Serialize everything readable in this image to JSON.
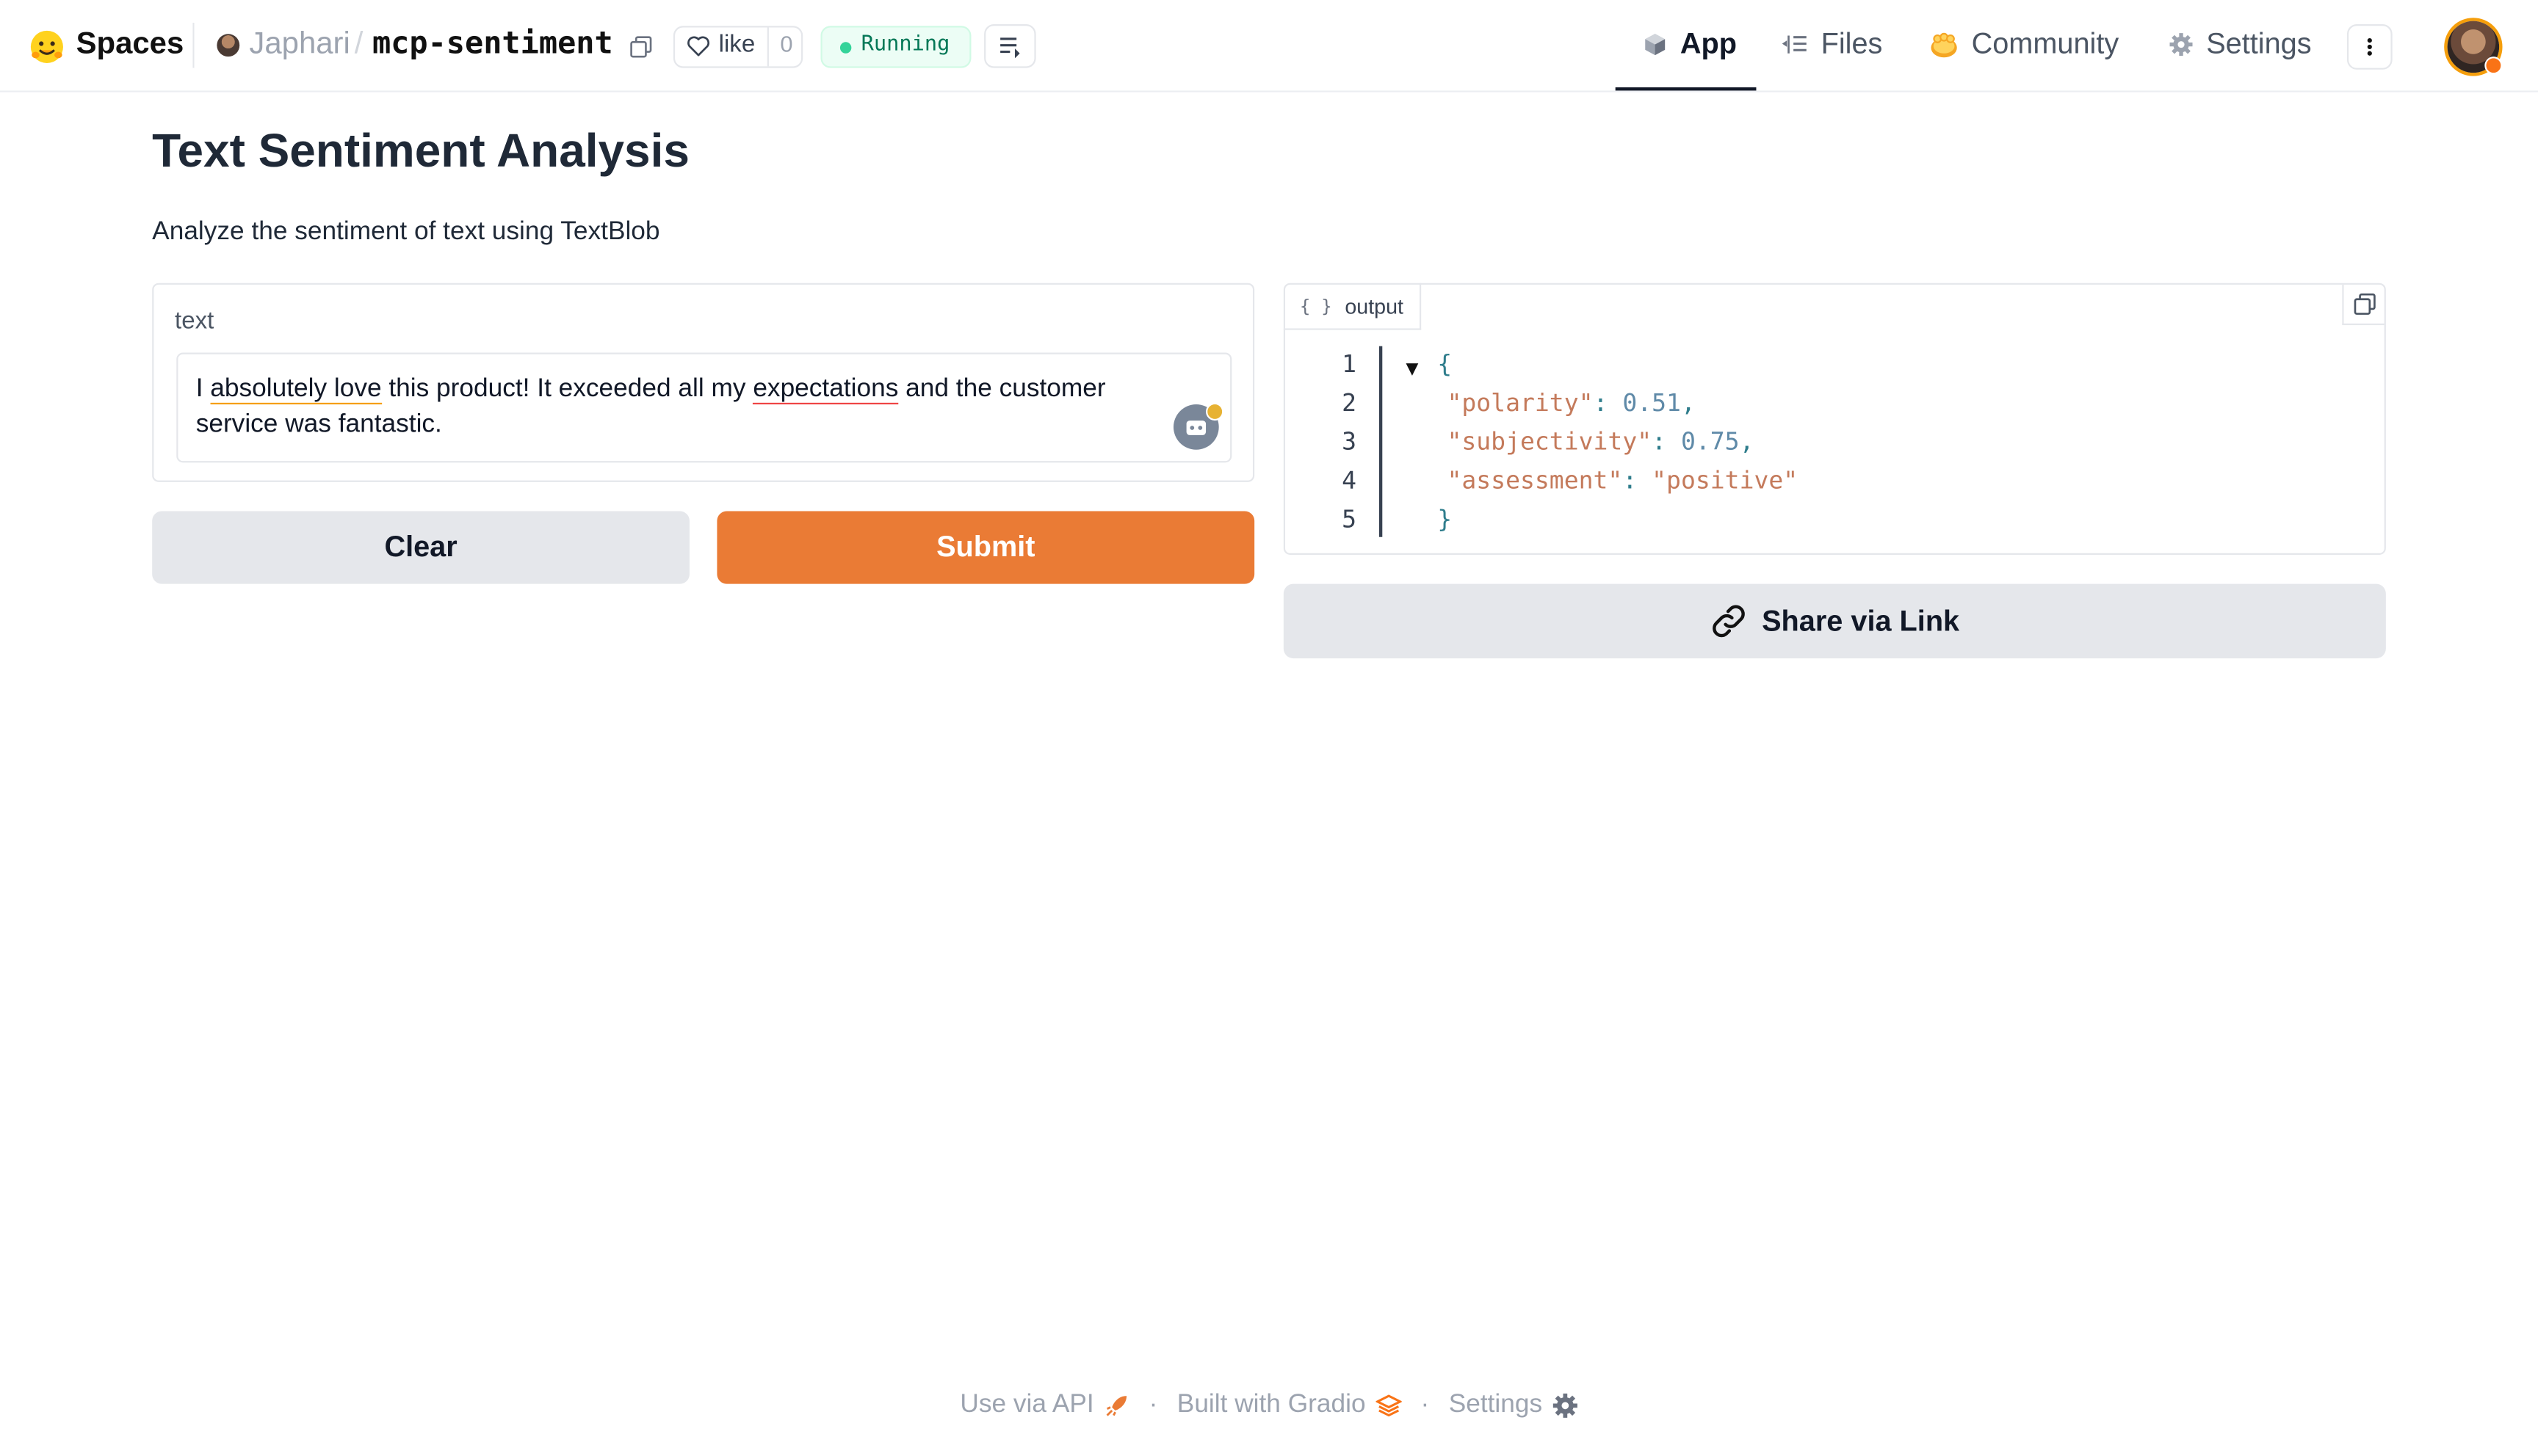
{
  "header": {
    "brand": "Spaces",
    "owner": "Japhari",
    "separator": "/",
    "repo": "mcp-sentiment",
    "like_label": "like",
    "like_count": "0",
    "status": "Running",
    "tabs": [
      {
        "label": "App",
        "icon": "cube-icon",
        "active": true
      },
      {
        "label": "Files",
        "icon": "files-icon",
        "active": false
      },
      {
        "label": "Community",
        "icon": "community-icon",
        "active": false
      },
      {
        "label": "Settings",
        "icon": "gear-icon",
        "active": false
      }
    ]
  },
  "app": {
    "title": "Text Sentiment Analysis",
    "description": "Analyze the sentiment of text using TextBlob",
    "input": {
      "label": "text",
      "value_parts": [
        "I ",
        "absolutely love",
        " this product! It exceeded all my ",
        "expectations",
        " and the customer service was fantastic."
      ]
    },
    "buttons": {
      "clear": "Clear",
      "submit": "Submit"
    },
    "output": {
      "label": "output",
      "label_icon": "{ }",
      "line_numbers": [
        "1",
        "2",
        "3",
        "4",
        "5"
      ],
      "open_brace": "{",
      "close_brace": "}",
      "collapse_glyph": "▼",
      "entries": [
        {
          "key": "\"polarity\"",
          "value": "0.51",
          "trail": ","
        },
        {
          "key": "\"subjectivity\"",
          "value": "0.75",
          "trail": ","
        },
        {
          "key": "\"assessment\"",
          "value": "\"positive\"",
          "trail": ""
        }
      ],
      "colon": ": "
    },
    "share_label": "Share via Link"
  },
  "footer": {
    "api": "Use via API",
    "built": "Built with Gradio",
    "settings": "Settings",
    "dot": "·"
  },
  "colors": {
    "submit": "#ea7b35",
    "button_gray": "#e5e7eb",
    "running_green": "#34d399"
  }
}
